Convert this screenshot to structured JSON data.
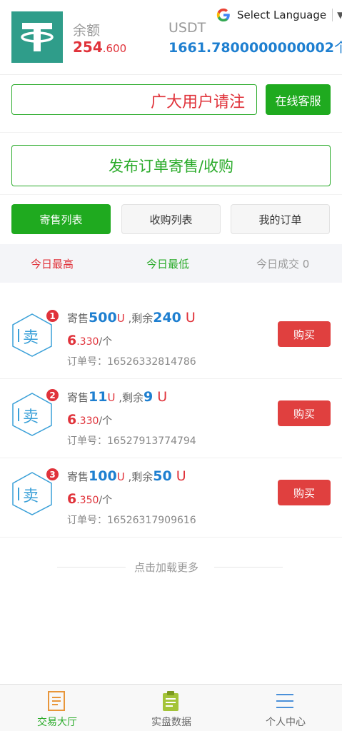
{
  "header": {
    "balance_label": "余额",
    "balance_int": "254",
    "balance_dec": ".600",
    "usdt_label": "USDT",
    "usdt_value": "1661.7800000000002",
    "usdt_unit": "个",
    "logo_icon": "tether-logo-icon",
    "brand_color": "#2f9d8a"
  },
  "language": {
    "label": "Select Language",
    "icon": "google-icon",
    "caret": "▼"
  },
  "notice": {
    "text": "广大用户请注",
    "service_label": "在线客服"
  },
  "publish": {
    "label": "发布订单寄售/收购"
  },
  "tabs": [
    {
      "label": "寄售列表",
      "active": true
    },
    {
      "label": "收购列表",
      "active": false
    },
    {
      "label": "我的订单",
      "active": false
    }
  ],
  "stats": {
    "high_label": "今日最高",
    "low_label": "今日最低",
    "volume_label": "今日成交 0"
  },
  "orders": [
    {
      "rank": "1",
      "sell_char": "卖",
      "prefix": "寄售",
      "amount": "500",
      "unit": "U",
      "remain_label": " ,剩余",
      "remain": "240",
      "remain_unit": " U",
      "price_int": "6",
      "price_dec": ".330",
      "price_unit": "/个",
      "order_label": "订单号：",
      "order_no": "16526332814786",
      "buy_label": "购买"
    },
    {
      "rank": "2",
      "sell_char": "卖",
      "prefix": "寄售",
      "amount": "11",
      "unit": "U",
      "remain_label": " ,剩余",
      "remain": "9",
      "remain_unit": " U",
      "price_int": "6",
      "price_dec": ".330",
      "price_unit": "/个",
      "order_label": "订单号：",
      "order_no": "16527913774794",
      "buy_label": "购买"
    },
    {
      "rank": "3",
      "sell_char": "卖",
      "prefix": "寄售",
      "amount": "100",
      "unit": "U",
      "remain_label": " ,剩余",
      "remain": "50",
      "remain_unit": " U",
      "price_int": "6",
      "price_dec": ".350",
      "price_unit": "/个",
      "order_label": "订单号：",
      "order_no": "16526317909616",
      "buy_label": "购买"
    }
  ],
  "load_more": "点击加载更多",
  "nav": [
    {
      "label": "交易大厅",
      "icon": "document-icon",
      "active": true
    },
    {
      "label": "实盘数据",
      "icon": "clipboard-icon",
      "active": false
    },
    {
      "label": "个人中心",
      "icon": "menu-icon",
      "active": false
    }
  ],
  "colors": {
    "green": "#1faa1f",
    "red": "#e0323a",
    "blue": "#1e7fd0"
  }
}
